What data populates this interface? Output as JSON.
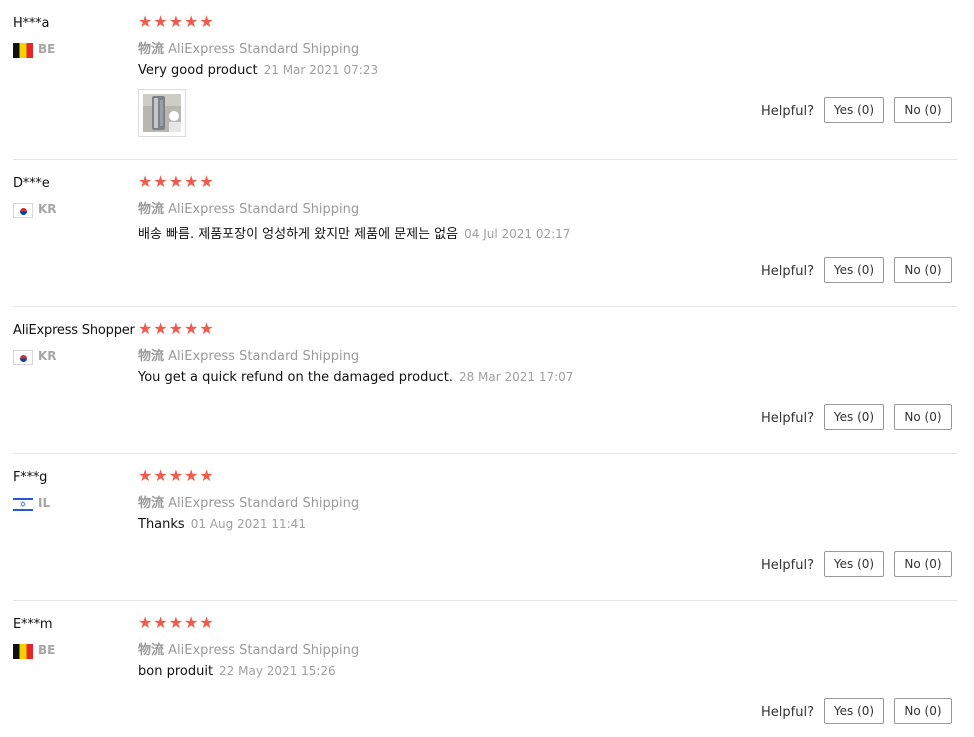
{
  "reviews": [
    {
      "username": "H***a",
      "country_code": "BE",
      "flag": "belgium-flag",
      "rating": 5,
      "logistics_label": "物流",
      "logistics_value": "AliExpress Standard Shipping",
      "text": "Very good product",
      "date": "21 Mar 2021 07:23",
      "has_photo": true,
      "helpful_label": "Helpful?",
      "yes_label": "Yes (0)",
      "no_label": "No (0)"
    },
    {
      "username": "D***e",
      "country_code": "KR",
      "flag": "korea-flag",
      "rating": 5,
      "logistics_label": "物流",
      "logistics_value": "AliExpress Standard Shipping",
      "text": "배송 빠름. 제품포장이 엉성하게 왔지만 제품에 문제는 없음",
      "date": "04 Jul 2021 02:17",
      "has_photo": false,
      "helpful_label": "Helpful?",
      "yes_label": "Yes (0)",
      "no_label": "No (0)"
    },
    {
      "username": "AliExpress Shopper",
      "country_code": "KR",
      "flag": "korea-flag",
      "rating": 5,
      "logistics_label": "物流",
      "logistics_value": "AliExpress Standard Shipping",
      "text": "You get a quick refund on the damaged product.",
      "date": "28 Mar 2021 17:07",
      "has_photo": false,
      "helpful_label": "Helpful?",
      "yes_label": "Yes (0)",
      "no_label": "No (0)"
    },
    {
      "username": "F***g",
      "country_code": "IL",
      "flag": "israel-flag",
      "rating": 5,
      "logistics_label": "物流",
      "logistics_value": "AliExpress Standard Shipping",
      "text": "Thanks",
      "date": "01 Aug 2021 11:41",
      "has_photo": false,
      "helpful_label": "Helpful?",
      "yes_label": "Yes (0)",
      "no_label": "No (0)"
    },
    {
      "username": "E***m",
      "country_code": "BE",
      "flag": "belgium-flag",
      "rating": 5,
      "logistics_label": "物流",
      "logistics_value": "AliExpress Standard Shipping",
      "text": "bon produit",
      "date": "22 May 2021 15:26",
      "has_photo": false,
      "helpful_label": "Helpful?",
      "yes_label": "Yes (0)",
      "no_label": "No (0)"
    }
  ],
  "colors": {
    "star": "#f05b4b",
    "muted": "#9a9a9a",
    "divider": "#e4e4e4"
  }
}
